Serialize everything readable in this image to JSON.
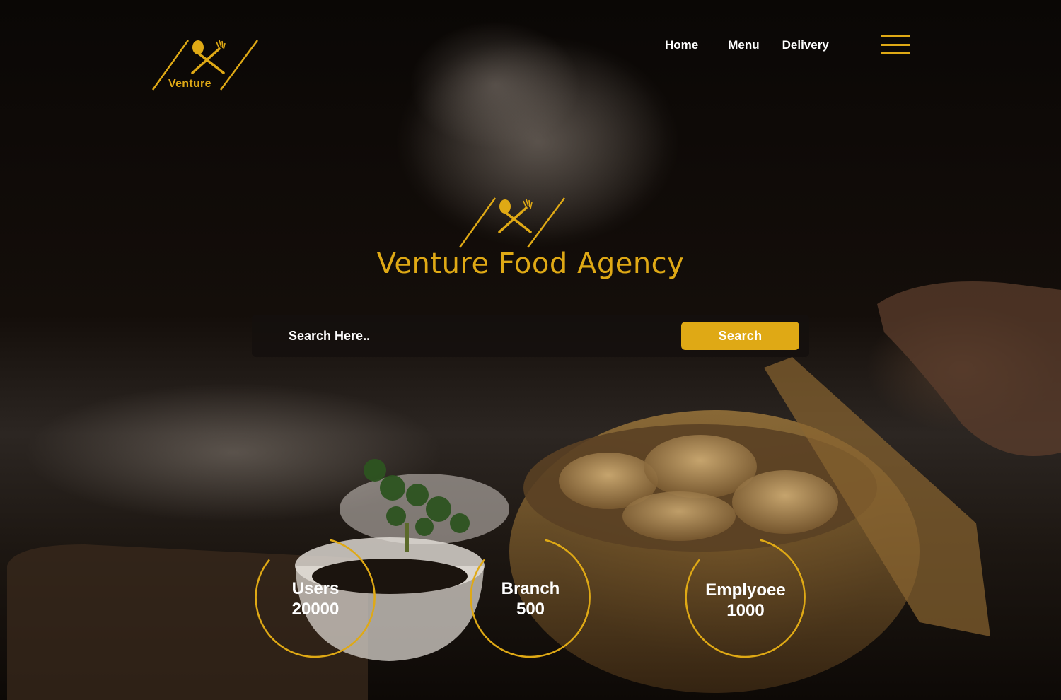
{
  "brand": {
    "logo_text": "Venture",
    "hero_title": "Venture Food Agency"
  },
  "nav": {
    "items": [
      {
        "label": "Home"
      },
      {
        "label": "Menu"
      },
      {
        "label": "Delivery"
      }
    ]
  },
  "search": {
    "placeholder": "Search Here..",
    "value": "",
    "button_label": "Search"
  },
  "stats": [
    {
      "label": "Users",
      "value": "20000"
    },
    {
      "label": "Branch",
      "value": "500"
    },
    {
      "label": "Emplyoee",
      "value": "1000"
    }
  ],
  "colors": {
    "accent": "#dfa915",
    "text": "#ffffff",
    "background": "#0c0806"
  },
  "icons": [
    "spoon-fork-cross-icon",
    "hamburger-menu-icon"
  ]
}
